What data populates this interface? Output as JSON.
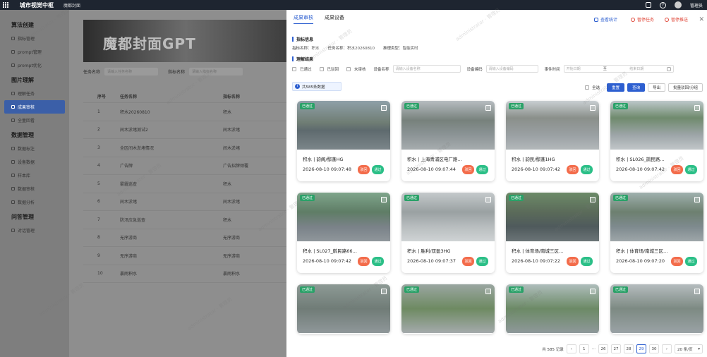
{
  "topbar": {
    "brand": "城市视觉中枢",
    "sub": "魔都封面",
    "user": "管理员"
  },
  "sidebar": {
    "groups": [
      {
        "title": "算法创建",
        "items": [
          "指标管理",
          "prompt管理",
          "prompt优化"
        ]
      },
      {
        "title": "图片理解",
        "items": [
          "理解任务",
          "成果审核",
          "全量回看"
        ]
      },
      {
        "title": "数据管理",
        "items": [
          "数据标注",
          "设备数据",
          "样本库",
          "数据审核",
          "数据分析"
        ]
      },
      {
        "title": "问答管理",
        "items": [
          "对话管理"
        ]
      }
    ]
  },
  "bg": {
    "banner": "魔都封面GPT",
    "filter_label1": "任务名称",
    "filter_ph1": "请输入任务名称",
    "filter_label2": "指标名称",
    "filter_ph2": "请输入指标名称",
    "headers": [
      "序号",
      "任务名称",
      "指标名称"
    ],
    "rows": [
      [
        "1",
        "积水20260810",
        "积水"
      ],
      [
        "2",
        "间木淤堵测试2",
        "间木淤堵"
      ],
      [
        "3",
        "全区间木淤堵情况",
        "间木淤堵"
      ],
      [
        "4",
        "广告牌",
        "广告招牌倾覆"
      ],
      [
        "5",
        "雾霾巡查",
        "积水"
      ],
      [
        "6",
        "间木淤堵",
        "间木淤堵"
      ],
      [
        "7",
        "防汛应急巡查",
        "积水"
      ],
      [
        "8",
        "无序游商",
        "无序游商"
      ],
      [
        "9",
        "无序游商",
        "无序游商"
      ],
      [
        "10",
        "暴雨积水",
        "暴雨积水"
      ]
    ]
  },
  "drawer": {
    "tabs": [
      "成果审核",
      "成果设备"
    ],
    "actions": [
      "查看统计",
      "暂停任务",
      "暂停推送"
    ],
    "sect1": "指标信息",
    "info": [
      {
        "k": "指标名称：",
        "v": "积水"
      },
      {
        "k": "任务名称：",
        "v": "积水20260810"
      },
      {
        "k": "推理类型：",
        "v": "智能实时"
      }
    ],
    "sect2": "理解结果",
    "filters": {
      "opts": [
        "已通过",
        "已驳回",
        "未审核"
      ],
      "device_label": "设备名称",
      "device_ph": "请输入设备名称",
      "code_label": "设备编码",
      "code_ph": "请输入设备编码",
      "time_label": "事件时间",
      "start_ph": "开始日期",
      "sep": "至",
      "end_ph": "结束日期"
    },
    "notice": "共585条数据",
    "ops": {
      "all": "全选",
      "reset": "重置",
      "query": "查询",
      "export": "导出",
      "batch": "批量驳回/分组"
    },
    "cards": [
      {
        "badge": "已通过",
        "title": "积水 | 韵阁/鄢蓬HG",
        "time": "2026-08-10 09:07:48",
        "reject": "驳回",
        "pass": "通过"
      },
      {
        "badge": "已通过",
        "title": "积水 | 上海青浦区电厂路…",
        "time": "2026-08-10 09:07:44",
        "reject": "驳回",
        "pass": "通过"
      },
      {
        "badge": "已通过",
        "title": "积水 | 韵民/鄢蓬1HG",
        "time": "2026-08-10 09:07:42",
        "reject": "驳回",
        "pass": "通过"
      },
      {
        "badge": "已通过",
        "title": "积水 | SL026_鹊民路…",
        "time": "2026-08-10 09:07:42",
        "reject": "驳回",
        "pass": "通过"
      },
      {
        "badge": "已通过",
        "title": "积水 | SL027_鹤民路66…",
        "time": "2026-08-10 09:07:42",
        "reject": "驳回",
        "pass": "通过"
      },
      {
        "badge": "已通过",
        "title": "积水 | 胜利/双盈3HG",
        "time": "2026-08-10 09:07:37",
        "reject": "驳回",
        "pass": "通过"
      },
      {
        "badge": "已通过",
        "title": "积水 | 体育场/南城三区…",
        "time": "2026-08-10 09:07:22",
        "reject": "驳回",
        "pass": "通过"
      },
      {
        "badge": "已通过",
        "title": "积水 | 体育场/南城三区…",
        "time": "2026-08-10 09:07:20",
        "reject": "驳回",
        "pass": "通过"
      },
      {
        "badge": "已通过"
      },
      {
        "badge": "已通过"
      },
      {
        "badge": "已通过"
      },
      {
        "badge": "已通过"
      }
    ],
    "pager": {
      "total": "共 585 记录",
      "pages": [
        "1",
        "26",
        "27",
        "28",
        "29",
        "30"
      ],
      "dots": "···",
      "size": "20 条/页"
    }
  },
  "watermark": "administrator · 管理员"
}
